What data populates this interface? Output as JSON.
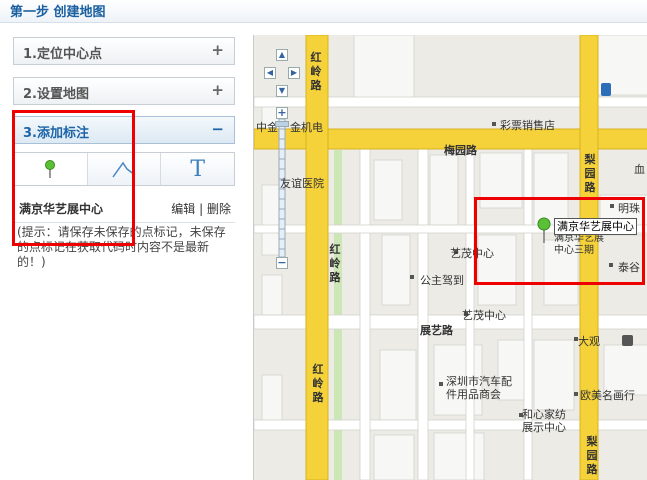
{
  "header": {
    "title": "第一步 创建地图"
  },
  "panels": [
    {
      "label": "1.定位中心点",
      "symbol": "+"
    },
    {
      "label": "2.设置地图",
      "symbol": "+"
    },
    {
      "label": "3.添加标注",
      "symbol": "−"
    }
  ],
  "tools": [
    {
      "name": "marker-tool",
      "icon": "pin-icon"
    },
    {
      "name": "line-tool",
      "icon": "polyline-icon"
    },
    {
      "name": "text-tool",
      "glyph": "T"
    }
  ],
  "entry": {
    "name": "满京华艺展中心",
    "edit": "编辑",
    "separator": "|",
    "delete": "删除"
  },
  "hint": "(提示：请保存未保存的点标记，未保存的点标记在获取代码时内容不是最新的！)",
  "map": {
    "zoom_plus": "+",
    "zoom_minus": "−",
    "marker_label": "满京华艺展中心",
    "labels": {
      "meiyuan_road": "梅园路",
      "zhanyi_road": "展艺路",
      "lottery": "彩票销售店",
      "hospital": "友谊医院",
      "yimao1": "艺茂中心",
      "yimao2": "艺茂中心",
      "gongzhu": "公主驾到",
      "zhongjinjiao": "中金",
      "jinkeji": "金机电",
      "mingzhu": "明珠",
      "taigu": "泰谷",
      "zhanyi_3": "满京华艺展中心三期",
      "daguan": "大观",
      "shenzhen_auto": "深圳市汽车配件用品商会",
      "oumei": "欧美名画行",
      "hexin": "和心家纺展示中心",
      "hongling_1": "红岭路",
      "hongling_2": "红岭路",
      "hongling_3": "红岭路",
      "liyuan_1": "梨园路",
      "liyuan_2": "梨园路",
      "edge_char": "血"
    },
    "colors": {
      "main_road": "#f5d23a",
      "minor_road": "#ffffff",
      "block": "#f8f8f6",
      "highlight": "#e00000",
      "marker": "#5cc036"
    }
  }
}
